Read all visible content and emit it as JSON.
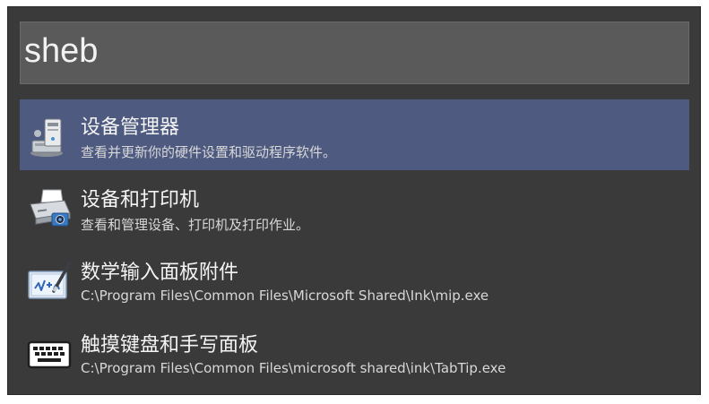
{
  "search": {
    "value": "sheb"
  },
  "results": [
    {
      "title": "设备管理器",
      "subtitle": "查看并更新你的硬件设置和驱动程序软件。",
      "icon": "device-manager-icon",
      "selected": true
    },
    {
      "title": "设备和打印机",
      "subtitle": "查看和管理设备、打印机及打印作业。",
      "icon": "printer-icon",
      "selected": false
    },
    {
      "title": "数学输入面板附件",
      "subtitle": "C:\\Program Files\\Common Files\\Microsoft Shared\\Ink\\mip.exe",
      "icon": "math-input-panel-icon",
      "selected": false
    },
    {
      "title": "触摸键盘和手写面板",
      "subtitle": "C:\\Program Files\\Common Files\\microsoft shared\\ink\\TabTip.exe",
      "icon": "keyboard-icon",
      "selected": false
    }
  ],
  "colors": {
    "background": "#3a3a3a",
    "search_box": "#5a5a5a",
    "selected_row": "#4e5a80",
    "text": "#f4f4f4"
  }
}
